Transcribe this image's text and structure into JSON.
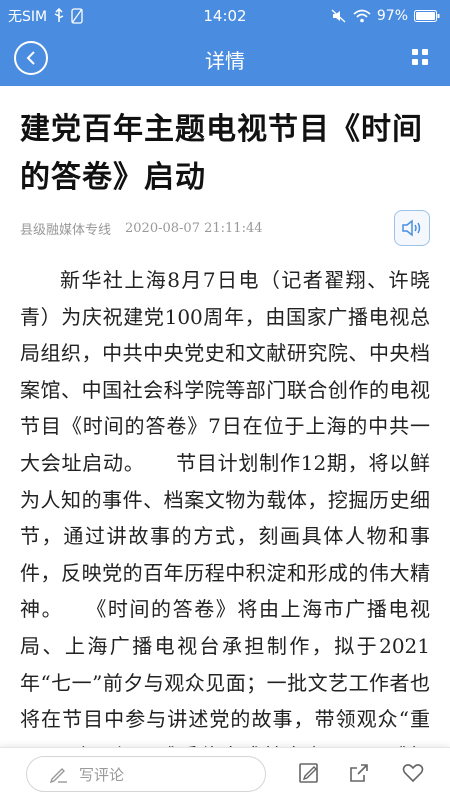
{
  "status_bar": {
    "carrier": "无SIM",
    "time": "14:02",
    "battery": "97%"
  },
  "navbar": {
    "title": "详情"
  },
  "article": {
    "title": "建党百年主题电视节目《时间的答卷》启动",
    "source": "县级融媒体专线",
    "datetime": "2020-08-07 21:11:44",
    "body": "新华社上海8月7日电（记者翟翔、许晓青）为庆祝建党100周年，由国家广播电视总局组织，中共中央党史和文献研究院、中央档案馆、中国社会科学院等部门联合创作的电视节目《时间的答卷》7日在位于上海的中共一大会址启动。　　节目计划制作12期，将以鲜为人知的事件、档案文物为载体，挖掘历史细节，通过讲故事的方式，刻画具体人物和事件，反映党的百年历程中积淀和形成的伟大精神。　　《时间的答卷》将由上海市广播电视局、上海广播电视台承担制作，拟于2021年“七一”前夕与观众见面；一批文艺工作者也将在节目中参与讲述党的故事，带领观众“重回”历史现场，感受伟大成就来之不易，感悟中国共产党为"
  },
  "bottom_bar": {
    "comment_placeholder": "写评论"
  },
  "colors": {
    "brand": "#4a8de0"
  },
  "icons": [
    "back-arrow-icon",
    "more-grid-icon",
    "audio-speaker-icon",
    "pencil-icon",
    "edit-icon",
    "share-icon",
    "heart-icon"
  ]
}
